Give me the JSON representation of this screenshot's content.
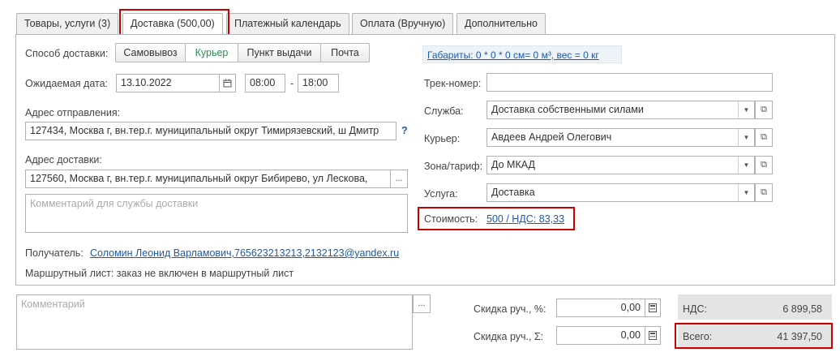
{
  "tabs": [
    {
      "label": "Товары, услуги (3)"
    },
    {
      "label": "Доставка (500,00)"
    },
    {
      "label": "Платежный календарь"
    },
    {
      "label": "Оплата (Вручную)"
    },
    {
      "label": "Дополнительно"
    }
  ],
  "delivery": {
    "method_label": "Способ доставки:",
    "methods": [
      "Самовывоз",
      "Курьер",
      "Пункт выдачи",
      "Почта"
    ],
    "selected_method": "Курьер",
    "expected_date_label": "Ожидаемая дата:",
    "date": "13.10.2022",
    "time_from": "08:00",
    "time_sep": "-",
    "time_to": "18:00",
    "from_address_label": "Адрес отправления:",
    "from_address": "127434, Москва г, вн.тер.г. муниципальный округ Тимирязевский, ш Дмитр",
    "help": "?",
    "to_address_label": "Адрес доставки:",
    "to_address": "127560, Москва г, вн.тер.г. муниципальный округ Бибирево, ул Лескова,",
    "ellipsis": "...",
    "comment_placeholder": "Комментарий для службы доставки",
    "recipient_label": "Получатель:",
    "recipient": "Соломин Леонид Варламович,765623213213,2132123@yandex.ru",
    "route_sheet": "Маршрутный лист: заказ не включен в маршрутный лист",
    "dimensions_link": "Габариты: 0 * 0 * 0 см= 0 м³, вес = 0 кг",
    "track_label": "Трек-номер:",
    "track_value": "",
    "service_label": "Служба:",
    "service_value": "Доставка собственными силами",
    "courier_label": "Курьер:",
    "courier_value": "Авдеев Андрей Олегович",
    "zone_label": "Зона/тариф:",
    "zone_value": "До МКАД",
    "product_label": "Услуга:",
    "product_value": "Доставка",
    "cost_label": "Стоимость:",
    "cost_value": "500 / НДС: 83,33"
  },
  "footer": {
    "comment_placeholder": "Комментарий",
    "ellipsis": "...",
    "discount_pct_label": "Скидка руч., %:",
    "discount_pct_value": "0,00",
    "discount_sum_label": "Скидка руч., Σ:",
    "discount_sum_value": "0,00",
    "vat_label": "НДС:",
    "vat_value": "6 899,58",
    "total_label": "Всего:",
    "total_value": "41 397,50"
  },
  "colors": {
    "highlight": "#c80000",
    "link": "#1e5aa8",
    "selected_method": "#2e8b57"
  }
}
